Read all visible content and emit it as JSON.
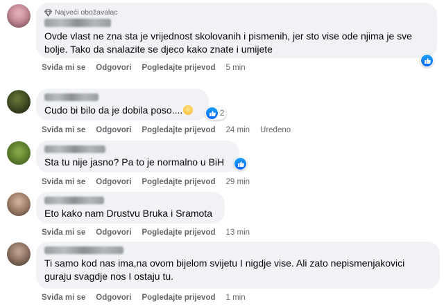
{
  "labels": {
    "like": "Sviđa mi se",
    "reply": "Odgovori",
    "translation": "Pogledajte prijevod"
  },
  "comments": [
    {
      "badge": "Najveći obožavalac",
      "text": "Ovde vlast ne zna sta je vrijednost skolovanih i pismenih, jer sto vise ode njima je sve bolje. Tako da snalazite se djeco kako znate i umijete",
      "time": "5 min",
      "reactions": {
        "icons": [
          "like-icon"
        ],
        "count": ""
      }
    },
    {
      "text": "Cudo bi bilo da je dobila poso....",
      "time": "24 min",
      "edited": "Uređeno",
      "reactions": {
        "icons": [
          "haha-icon",
          "like-icon"
        ],
        "count": "2"
      }
    },
    {
      "text": "Sta tu nije jasno? Pa to je normalno u BiH",
      "time": "29 min",
      "reactions": {
        "icons": [
          "like-icon"
        ],
        "count": ""
      }
    },
    {
      "text": "Eto kako nam Drustvu Bruka i Sramota",
      "time": "13 min"
    },
    {
      "text": "Ti samo kod nas ima,na ovom bijelom svijetu I nigdje vise. Ali zato nepismenjakovici guraju svagdje nos I ostaju tu.",
      "time": "1 min"
    }
  ],
  "colors": {
    "bubble": "#f0f2f5",
    "meta": "#65676b",
    "like": "#0866ff"
  }
}
